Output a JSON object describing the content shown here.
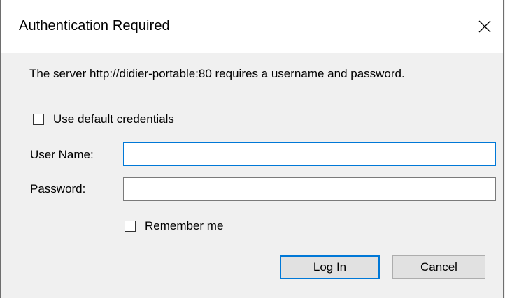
{
  "dialog": {
    "title": "Authentication Required",
    "message": "The server http://didier-portable:80 requires a username and password.",
    "use_default_credentials_label": "Use default credentials",
    "use_default_credentials_checked": false,
    "username_label": "User Name:",
    "username_value": "",
    "password_label": "Password:",
    "password_value": "",
    "remember_me_label": "Remember me",
    "remember_me_checked": false,
    "login_label": "Log In",
    "cancel_label": "Cancel"
  },
  "icons": {
    "close": "close-icon"
  },
  "colors": {
    "focus_accent": "#0078d7",
    "dialog_background": "#f0f0f0",
    "titlebar_background": "#ffffff",
    "button_background": "#e1e1e1"
  }
}
